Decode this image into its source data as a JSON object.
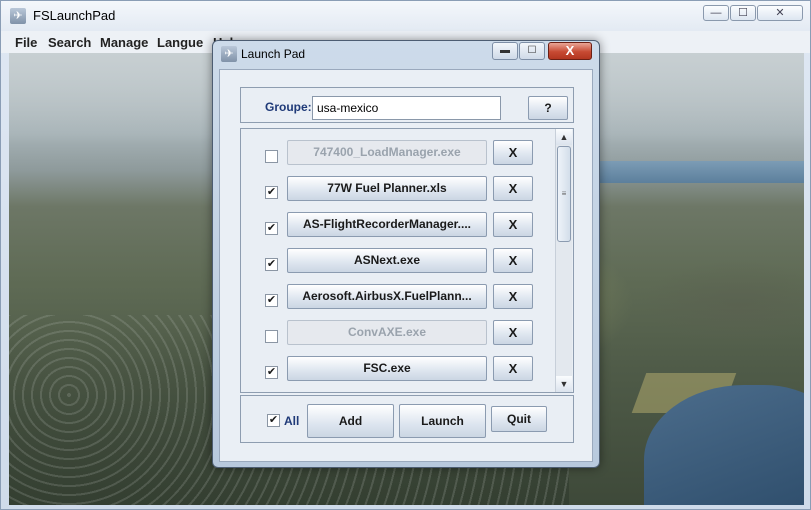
{
  "main_window": {
    "title": "FSLaunchPad",
    "app_icon": "✈",
    "controls": {
      "minimize": "—",
      "maximize": "☐",
      "close": "✕"
    }
  },
  "menu": {
    "items": [
      "File",
      "Search",
      "Manage",
      "Langue",
      "Help"
    ]
  },
  "dialog": {
    "title": "Launch Pad",
    "icon": "✈",
    "controls": {
      "minimize": "▬",
      "maximize": "☐",
      "close": "X"
    },
    "groupe_label": "Groupe:",
    "groupe_value": "usa-mexico",
    "help_label": "?",
    "items": [
      {
        "label": "747400_LoadManager.exe",
        "checked": false,
        "remove_label": "X"
      },
      {
        "label": "77W Fuel Planner.xls",
        "checked": true,
        "remove_label": "X"
      },
      {
        "label": "AS-FlightRecorderManager....",
        "checked": true,
        "remove_label": "X"
      },
      {
        "label": "ASNext.exe",
        "checked": true,
        "remove_label": "X"
      },
      {
        "label": "Aerosoft.AirbusX.FuelPlann...",
        "checked": true,
        "remove_label": "X"
      },
      {
        "label": "ConvAXE.exe",
        "checked": false,
        "remove_label": "X"
      },
      {
        "label": "FSC.exe",
        "checked": true,
        "remove_label": "X"
      }
    ],
    "all_label": "All",
    "all_checked": true,
    "add_label": "Add",
    "launch_label": "Launch",
    "quit_label": "Quit",
    "scroll": {
      "up": "▲",
      "down": "▼",
      "grip": "≡"
    }
  }
}
